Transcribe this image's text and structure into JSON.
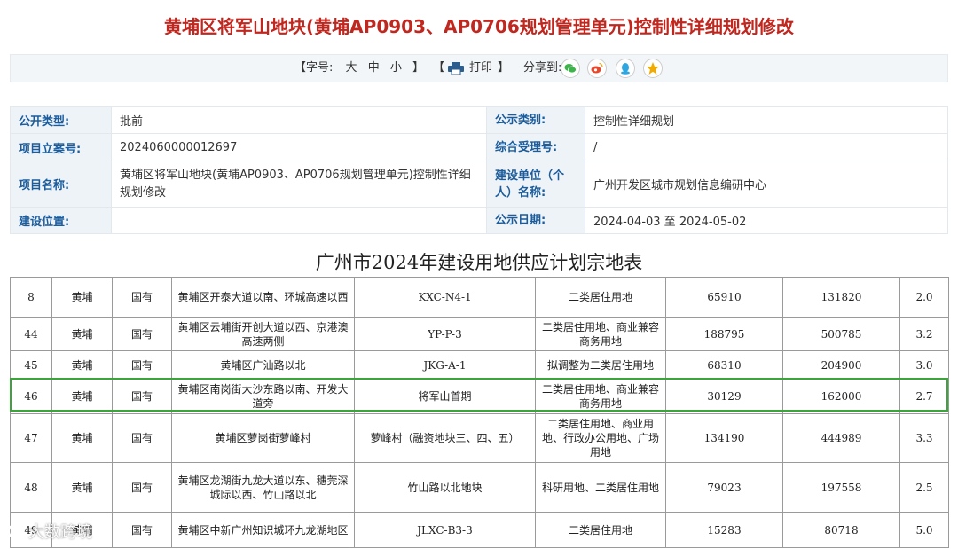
{
  "header": {
    "title": "黄埔区将军山地块(黄埔AP0903、AP0706规划管理单元)控制性详细规划修改"
  },
  "toolbar": {
    "size_prefix": "【字号:",
    "size_large": "大",
    "size_medium": "中",
    "size_small": "小",
    "size_suffix": "】",
    "print_open": "【",
    "print_label": "打印",
    "print_close": "】",
    "share_label": "分享到:",
    "share_icons": [
      "wechat-icon",
      "weibo-icon",
      "qq-icon",
      "qzone-icon"
    ],
    "share_colors": [
      "#3bb44a",
      "#e6482d",
      "#2ea7e0",
      "#f2a900"
    ]
  },
  "info": {
    "type_label": "公开类型:",
    "type_value": "批前",
    "category_label": "公示类别:",
    "category_value": "控制性详细规划",
    "project_no_label": "项目立案号:",
    "project_no_value": "2024060000012697",
    "accept_no_label": "综合受理号:",
    "accept_no_value": "/",
    "name_label": "项目名称:",
    "name_value": "黄埔区将军山地块(黄埔AP0903、AP0706规划管理单元)控制性详细规划修改",
    "unit_label": "建设单位（个人）名称:",
    "unit_value": "广州开发区城市规划信息编研中心",
    "location_label": "建设位置:",
    "location_value": "",
    "date_label": "公示日期:",
    "date_value": "2024-04-03 至 2024-05-02"
  },
  "screenshot_table": {
    "title": "广州市2024年建设用地供应计划宗地表",
    "rows": [
      [
        "8",
        "黄埔",
        "国有",
        "黄埔区开泰大道以南、环城高速以西",
        "KXC-N4-1",
        "二类居住用地",
        "65910",
        "131820",
        "2.0"
      ],
      [
        "44",
        "黄埔",
        "国有",
        "黄埔区云埔街开创大道以西、京港澳高速两侧",
        "YP-P-3",
        "二类居住用地、商业兼容商务用地",
        "188795",
        "500785",
        "3.2"
      ],
      [
        "45",
        "黄埔",
        "国有",
        "黄埔区广汕路以北",
        "JKG-A-1",
        "拟调整为二类居住用地",
        "68310",
        "204900",
        "3.0"
      ],
      [
        "46",
        "黄埔",
        "国有",
        "黄埔区南岗街大沙东路以南、开发大道旁",
        "将军山首期",
        "二类居住用地、商业兼容商务用地",
        "30129",
        "162000",
        "2.7"
      ],
      [
        "47",
        "黄埔",
        "国有",
        "黄埔区萝岗街萝峰村",
        "萝峰村（融资地块三、四、五）",
        "二类居住用地、商业用地、行政办公用地、广场用地",
        "134190",
        "444989",
        "3.3"
      ],
      [
        "48",
        "黄埔",
        "国有",
        "黄埔区龙湖街九龙大道以东、穗莞深城际以西、竹山路以北",
        "竹山路以北地块",
        "科研用地、二类居住用地",
        "79023",
        "197558",
        "2.5"
      ],
      [
        "49",
        "黄埔",
        "国有",
        "黄埔区中新广州知识城环九龙湖地区",
        "JLXC-B3-3",
        "二类居住用地",
        "15283",
        "80718",
        "5.0"
      ]
    ],
    "highlight_color": "#3aa63a"
  },
  "watermark": {
    "text": "大数跨境"
  }
}
